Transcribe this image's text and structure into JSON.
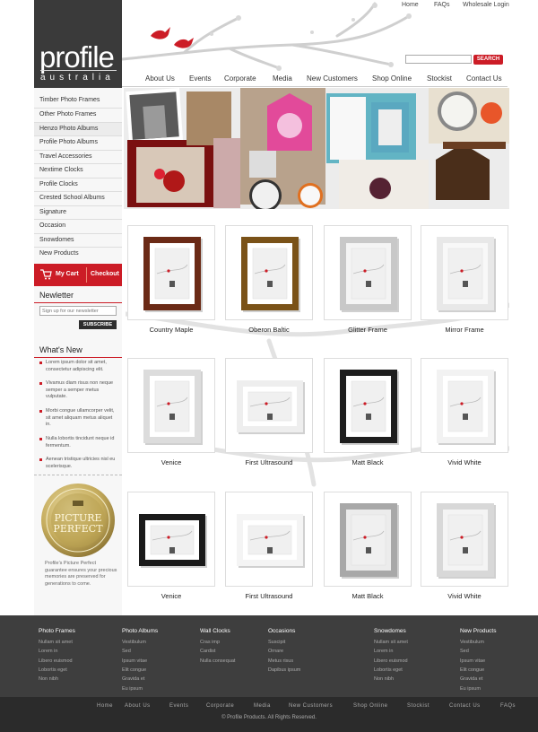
{
  "top_links": [
    "Home",
    "FAQs",
    "Wholesale Login"
  ],
  "logo": {
    "name": "profile",
    "sub": "australia"
  },
  "search": {
    "placeholder": "",
    "button": "SEARCH"
  },
  "nav": [
    "About Us",
    "Events",
    "Corporate",
    "Media",
    "New Customers",
    "Shop Online",
    "Stockist",
    "Contact Us"
  ],
  "sidebar": {
    "items": [
      "Timber Photo Frames",
      "Other Photo Frames",
      "Henzo Photo Albums",
      "Profile Photo Albums",
      "Travel Accessories",
      "Nextime Clocks",
      "Profile Clocks",
      "Crested School Albums",
      "Signature",
      "Occasion",
      "Snowdomes",
      "New Products"
    ],
    "active_index": 2
  },
  "cart": {
    "my_cart": "My Cart",
    "checkout": "Checkout"
  },
  "newsletter": {
    "title": "Newletter",
    "placeholder": "Sign up for our newsletter",
    "button": "SUBSCRIBE"
  },
  "whats_new": {
    "title": "What's New",
    "items": [
      "Lorem ipsum dolor sit amet, consectetur adipiscing elit.",
      "Vivamus diam risus non neque semper a semper metus vulputate.",
      "Morbi congue ullamcorper velit, sit amet aliquam metus aliquet in.",
      "Nulla lobortis tincidunt neque id fermentum.",
      "Aenean tristique ultricies nisl eu scelerisque."
    ]
  },
  "badge": {
    "line1": "PICTURE",
    "line2": "PERFECT",
    "text": "Profile's Picture Perfect guarantee ensures your precious memories are preserved for generations to come."
  },
  "products": [
    {
      "name": "Country Maple",
      "frame": "#6b2a16",
      "mat": "#ffffff",
      "style": "portrait"
    },
    {
      "name": "Oberon Baltic",
      "frame": "#7a5218",
      "mat": "#ffffff",
      "style": "portrait"
    },
    {
      "name": "Glitter Frame",
      "frame": "#c8c8c8",
      "mat": "#f4f4f4",
      "style": "portrait"
    },
    {
      "name": "Mirror Frame",
      "frame": "#e8e8e8",
      "mat": "#f8f8f8",
      "style": "portrait"
    },
    {
      "name": "Venice",
      "frame": "#dcdcdc",
      "mat": "#ffffff",
      "style": "portrait"
    },
    {
      "name": "First Ultrasound",
      "frame": "#eeeeee",
      "mat": "#ffffff",
      "style": "landscape"
    },
    {
      "name": "Matt Black",
      "frame": "#1e1e1e",
      "mat": "#ffffff",
      "style": "portrait"
    },
    {
      "name": "Vivid White",
      "frame": "#f2f2f2",
      "mat": "#ffffff",
      "style": "portrait"
    },
    {
      "name": "Venice",
      "frame": "#1a1a1a",
      "mat": "#ffffff",
      "style": "landscape"
    },
    {
      "name": "First Ultrasound",
      "frame": "#f4f4f4",
      "mat": "#ffffff",
      "style": "landscape"
    },
    {
      "name": "Matt Black",
      "frame": "#a8a8a8",
      "mat": "#ececec",
      "style": "portrait"
    },
    {
      "name": "Vivid White",
      "frame": "#d8d8d8",
      "mat": "#f4f4f4",
      "style": "portrait"
    }
  ],
  "footer": {
    "columns": [
      {
        "title": "Photo Frames",
        "links": [
          "Nullam sit amet",
          "Lorem in",
          "Libero euismod",
          "Lobortis eget",
          "Non nibh"
        ]
      },
      {
        "title": "Photo Albums",
        "links": [
          "Vestibulum",
          "Sed",
          "Ipsum vitae",
          "Elit congue",
          "Gravida et",
          "Eu ipsum"
        ]
      },
      {
        "title": "Wall Clocks",
        "links": [
          "Cras imp",
          "Cardist",
          "Nulla consequat"
        ]
      },
      {
        "title": "Occasions",
        "links": [
          "Suscipit",
          "Ornare",
          "Metus risus",
          "Dapibus ipsum"
        ]
      },
      {
        "title": "Snowdomes",
        "links": [
          "Nullam sit amet",
          "Lorem in",
          "Libero euismod",
          "Lobortis eget",
          "Non nibh"
        ]
      },
      {
        "title": "New Products",
        "links": [
          "Vestibulum",
          "Sed",
          "Ipsum vitae",
          "Elit congue",
          "Gravida et",
          "Eu ipsum"
        ]
      }
    ],
    "bottom_links": [
      "Home",
      "About Us",
      "Events",
      "Corporate",
      "Media",
      "New Customers",
      "Shop Online",
      "Stockist",
      "Contact Us",
      "FAQs"
    ],
    "copyright": "© Profile Products. All Rights Reserved."
  },
  "colors": {
    "accent": "#cc1c26",
    "logo_bg": "#3a3a3a",
    "footer_bg": "#3e3e3e",
    "footer_bottom": "#2b2b2b"
  }
}
